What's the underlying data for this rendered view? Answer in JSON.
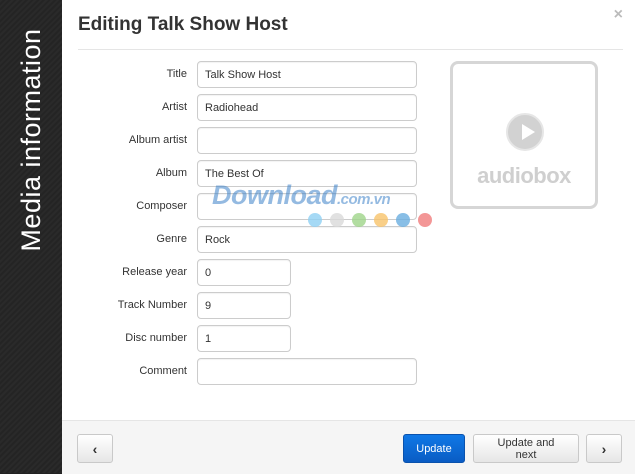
{
  "sidebar": {
    "label": "Media information"
  },
  "dialog": {
    "title": "Editing Talk Show Host",
    "close_glyph": "×"
  },
  "form": {
    "fields": [
      {
        "label": "Title",
        "value": "Talk Show Host",
        "size": "wide"
      },
      {
        "label": "Artist",
        "value": "Radiohead",
        "size": "wide"
      },
      {
        "label": "Album artist",
        "value": "",
        "size": "wide"
      },
      {
        "label": "Album",
        "value": "The Best Of",
        "size": "wide"
      },
      {
        "label": "Composer",
        "value": "",
        "size": "wide"
      },
      {
        "label": "Genre",
        "value": "Rock",
        "size": "wide"
      },
      {
        "label": "Release year",
        "value": "0",
        "size": "narrow"
      },
      {
        "label": "Track Number",
        "value": "9",
        "size": "narrow"
      },
      {
        "label": "Disc number",
        "value": "1",
        "size": "narrow"
      },
      {
        "label": "Comment",
        "value": "",
        "size": "wide"
      }
    ]
  },
  "cover": {
    "logo_text": "audiobox",
    "play_icon": "play-icon"
  },
  "footer": {
    "prev_glyph": "‹",
    "next_glyph": "›",
    "update_label": "Update",
    "update_next_label": "Update and next"
  },
  "watermark": {
    "text": "Download",
    "suffix": ".com.vn",
    "dot_colors": [
      "#8fd0f2",
      "#d9d9d9",
      "#9fd58a",
      "#f7c36a",
      "#6aaee0",
      "#f07c7c"
    ]
  },
  "colors": {
    "primary": "#0f78e6",
    "sidebar_bg": "#262626"
  }
}
